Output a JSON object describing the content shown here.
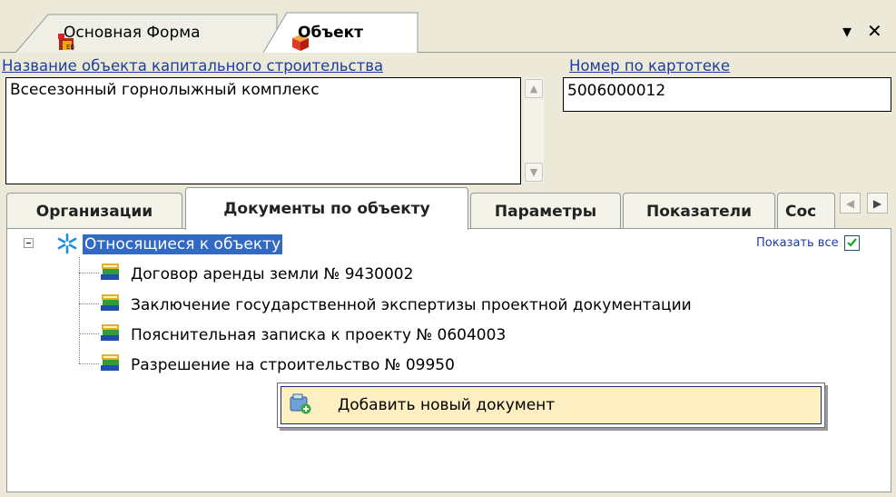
{
  "doc_tabs": [
    {
      "label": "Основная Форма",
      "icon": "form-app-icon",
      "active": false
    },
    {
      "label": "Объект",
      "icon": "object-box-icon",
      "active": true
    }
  ],
  "strip_buttons": {
    "dropdown": "▾",
    "close": "✕"
  },
  "form": {
    "name_label": "Название объекта капитального строительства",
    "name_value": "Всесезонный горнолыжный комплекс",
    "card_label": "Номер по картотеке",
    "card_value": "5006000012"
  },
  "inner_tabs": [
    {
      "label": "Организации"
    },
    {
      "label": "Документы по объекту"
    },
    {
      "label": "Параметры"
    },
    {
      "label": "Показатели"
    },
    {
      "label": "Сос"
    }
  ],
  "show_all": {
    "label": "Показать все",
    "checked": true
  },
  "tree": {
    "root": "Относящиеся к объекту",
    "items": [
      "Договор аренды земли № 9430002",
      "Заключение государственной экспертизы проектной документации",
      "Пояснительная записка к проекту № 0604003",
      "Разрешение на строительство № 09950"
    ]
  },
  "context_menu": {
    "add_document": "Добавить новый документ"
  },
  "colors": {
    "link_blue": "#1c3ca8",
    "selection": "#316ac5",
    "menu_highlight": "#fdefc2"
  }
}
